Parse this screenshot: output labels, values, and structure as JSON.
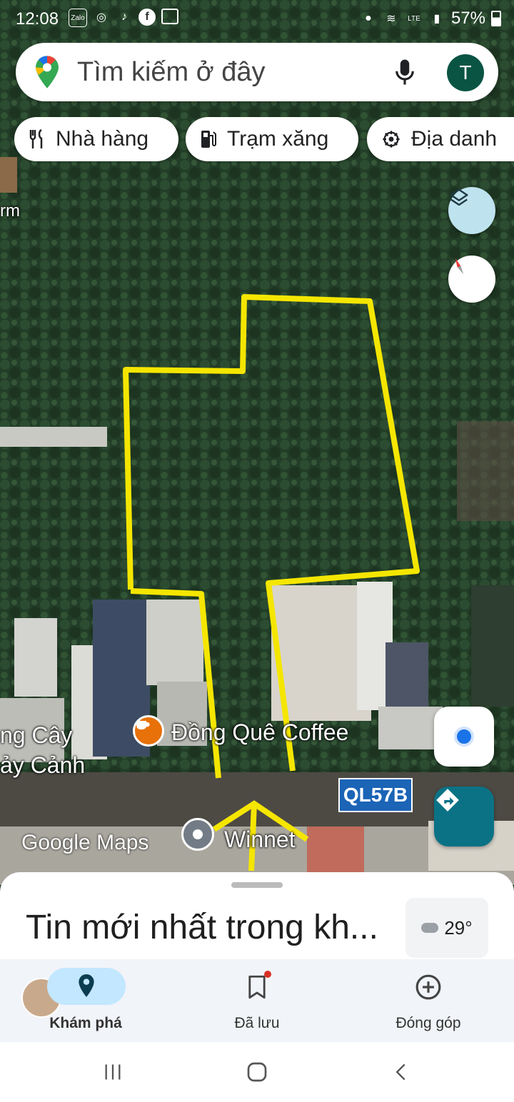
{
  "status_bar": {
    "time": "12:08",
    "battery": "57%"
  },
  "search": {
    "placeholder": "Tìm kiếm ở đây",
    "avatar_letter": "T"
  },
  "chips": [
    {
      "label": "Nhà hàng",
      "icon": "restaurant-icon"
    },
    {
      "label": "Trạm xăng",
      "icon": "gas-station-icon"
    },
    {
      "label": "Địa danh",
      "icon": "landmark-icon"
    }
  ],
  "map": {
    "labels": {
      "farm_partial": "rm",
      "shop_partial_1": "ng Cây",
      "shop_partial_2": "ảy Cảnh",
      "coffee": "Đồng Quê Coffee",
      "winnet": "Winnet"
    },
    "road_shield": "QL57B",
    "attribution": "Google Maps",
    "colors": {
      "boundary": "#f5e600",
      "road_shield": "#1b64b6",
      "coffee_pin": "#e8710a",
      "directions_fab": "#0b7285"
    }
  },
  "sheet": {
    "title": "Tin mới nhất trong kh...",
    "weather": "29°"
  },
  "bottom_nav": [
    {
      "label": "Khám phá",
      "icon": "explore-pin-icon"
    },
    {
      "label": "Đã lưu",
      "icon": "bookmark-icon"
    },
    {
      "label": "Đóng góp",
      "icon": "add-circle-icon"
    }
  ]
}
